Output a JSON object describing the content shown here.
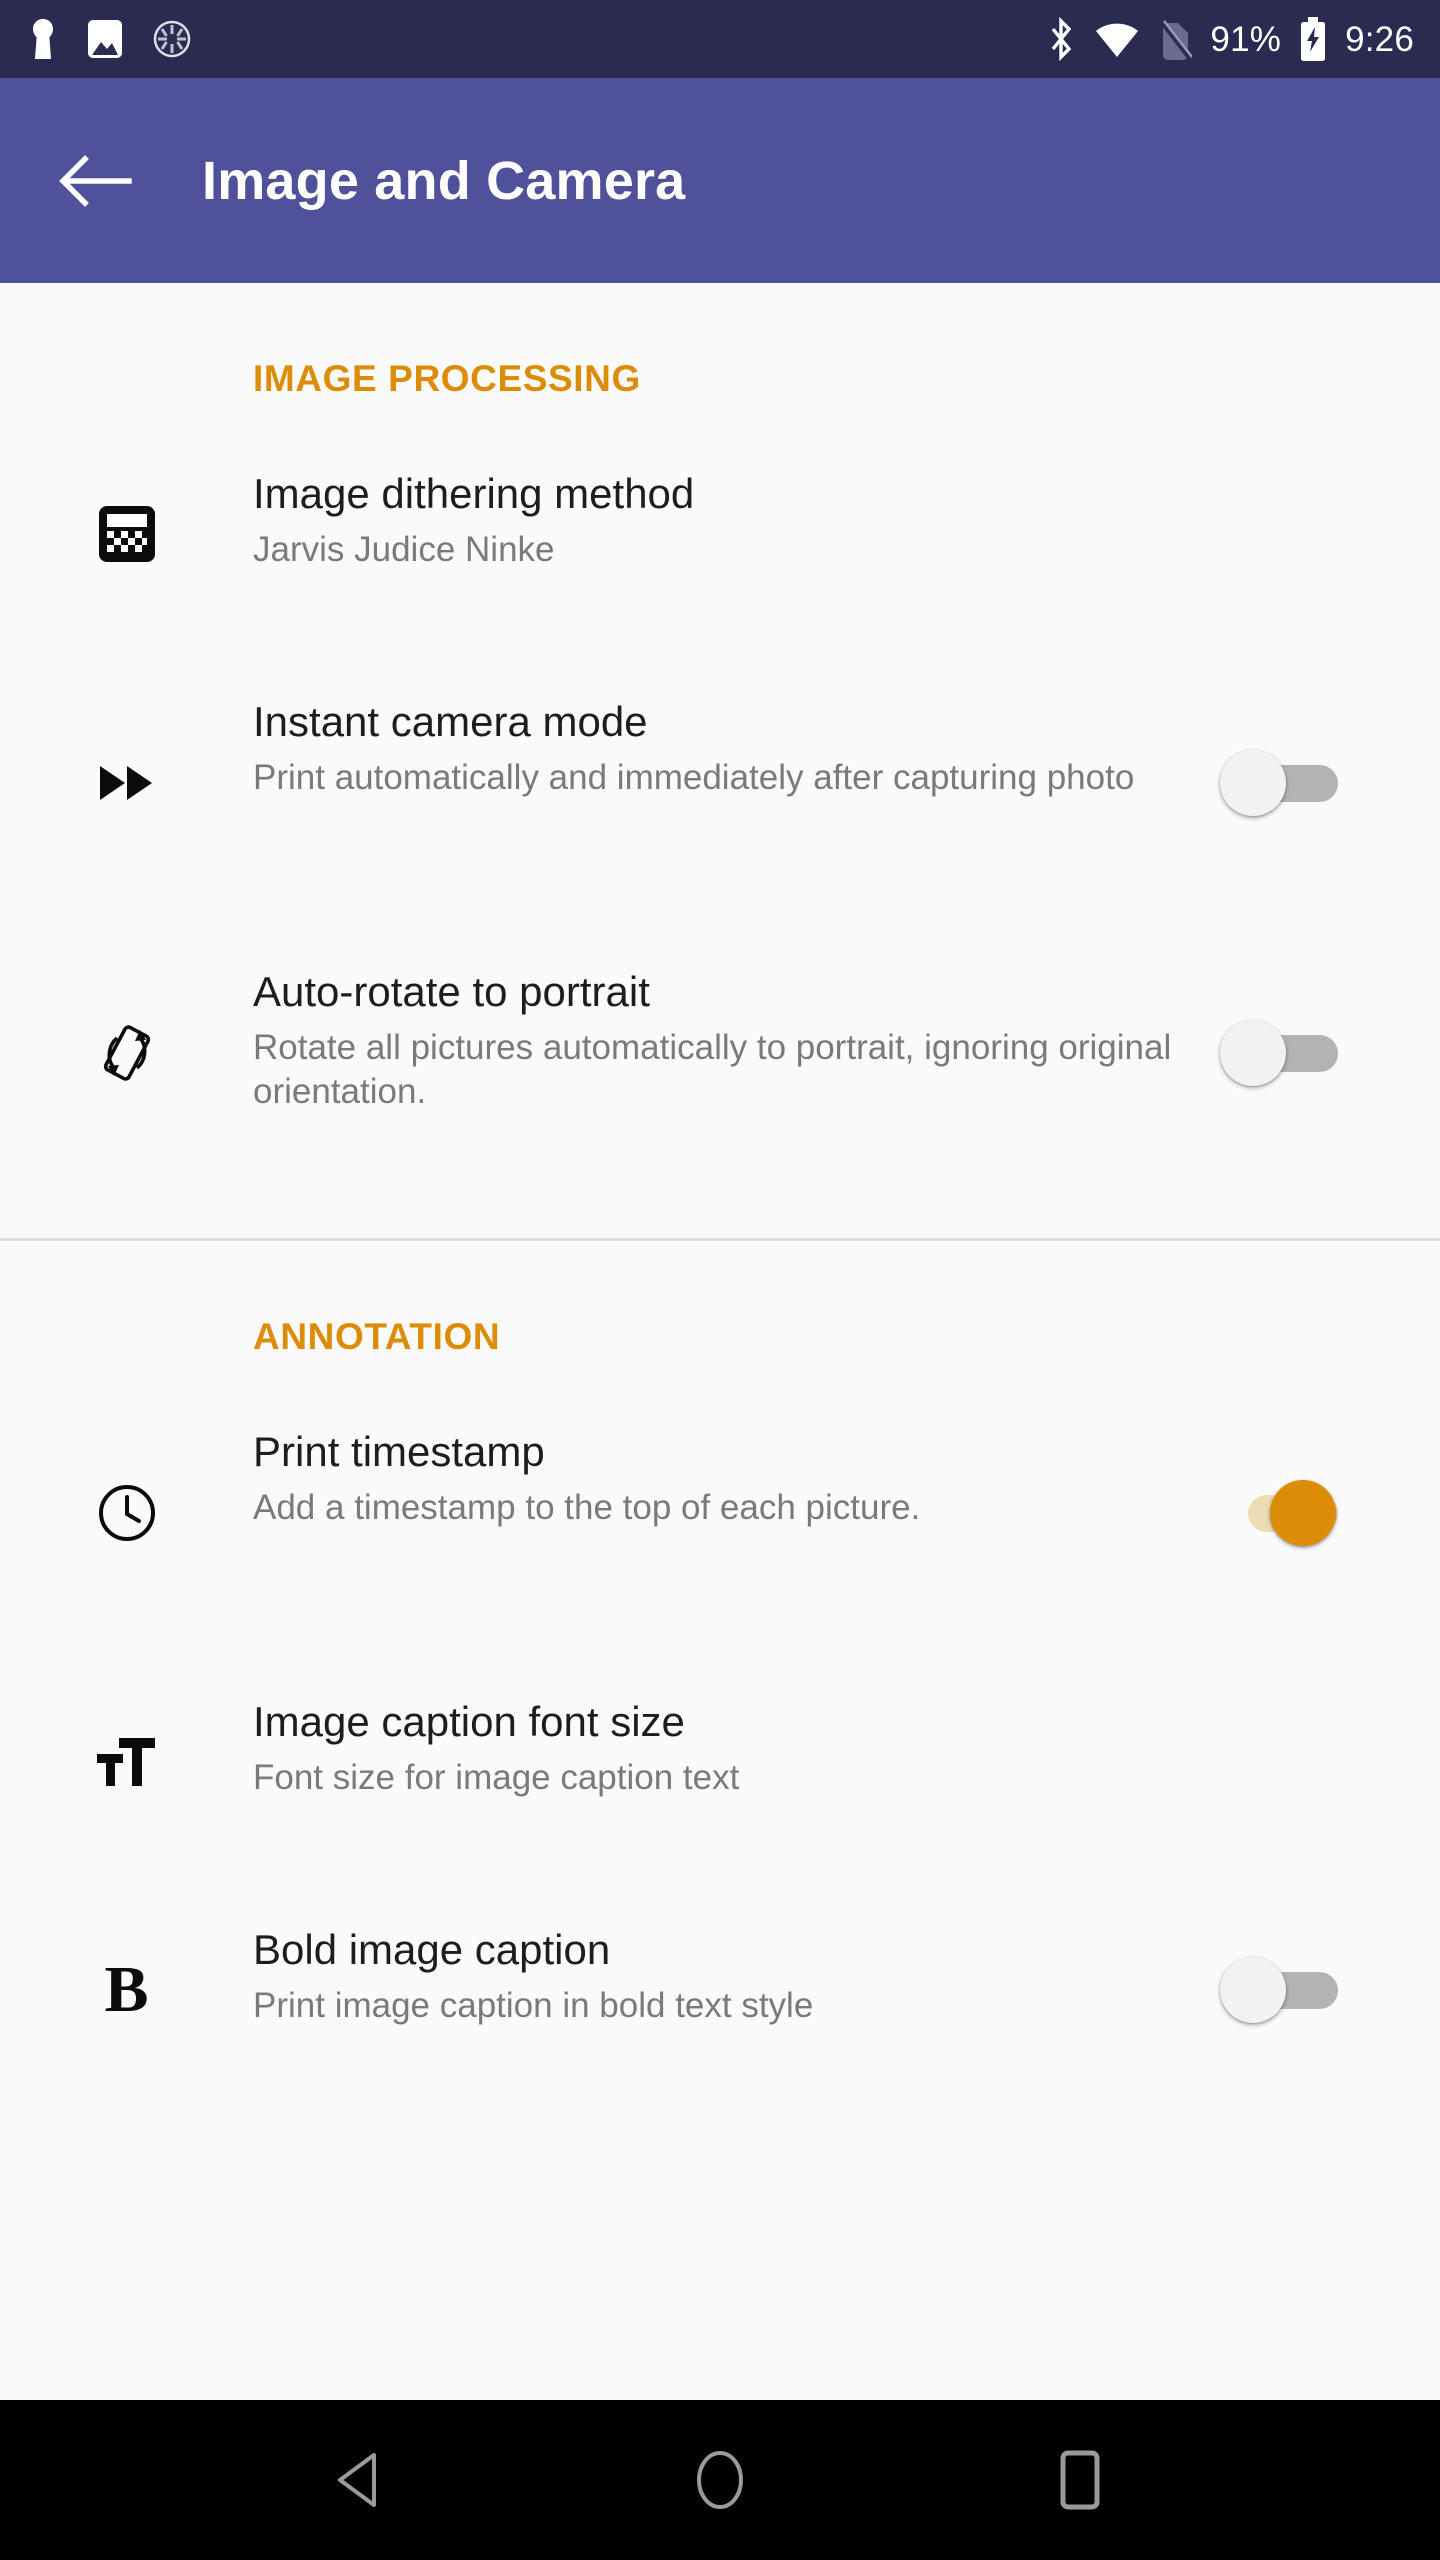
{
  "statusbar": {
    "battery_percent": "91%",
    "clock": "9:26",
    "left_icons": [
      "key-icon",
      "image-icon",
      "progress-spinner-icon"
    ],
    "right_icons": [
      "bluetooth-icon",
      "wifi-icon",
      "no-sim-icon",
      "battery-charging-icon"
    ],
    "background_color": "#2b2b51"
  },
  "appbar": {
    "title": "Image and Camera",
    "back_icon": "arrow-back-icon",
    "background_color": "#4f519a"
  },
  "accent_color": "#dd8c07",
  "sections": [
    {
      "header": "IMAGE PROCESSING",
      "items": [
        {
          "icon": "dither-grid-icon",
          "title": "Image dithering method",
          "subtitle": "Jarvis Judice Ninke",
          "control": "none",
          "state": ""
        },
        {
          "icon": "fast-forward-icon",
          "title": "Instant camera mode",
          "subtitle": "Print automatically and immediately after capturing photo",
          "control": "switch",
          "state": "off"
        },
        {
          "icon": "screen-rotation-icon",
          "title": "Auto-rotate to portrait",
          "subtitle": "Rotate all pictures automatically to portrait, ignoring original orientation.",
          "control": "switch",
          "state": "off"
        }
      ]
    },
    {
      "header": "ANNOTATION",
      "items": [
        {
          "icon": "clock-icon",
          "title": "Print timestamp",
          "subtitle": "Add a timestamp to the top of each picture.",
          "control": "switch",
          "state": "on"
        },
        {
          "icon": "format-size-icon",
          "title": "Image caption font size",
          "subtitle": "Font size for image caption text",
          "control": "none",
          "state": ""
        },
        {
          "icon": "bold-icon",
          "title": "Bold image caption",
          "subtitle": "Print image caption in bold text style",
          "control": "switch",
          "state": "off"
        }
      ]
    }
  ],
  "navbar": {
    "back_label": "back-nav",
    "home_label": "home-nav",
    "recents_label": "recents-nav"
  }
}
